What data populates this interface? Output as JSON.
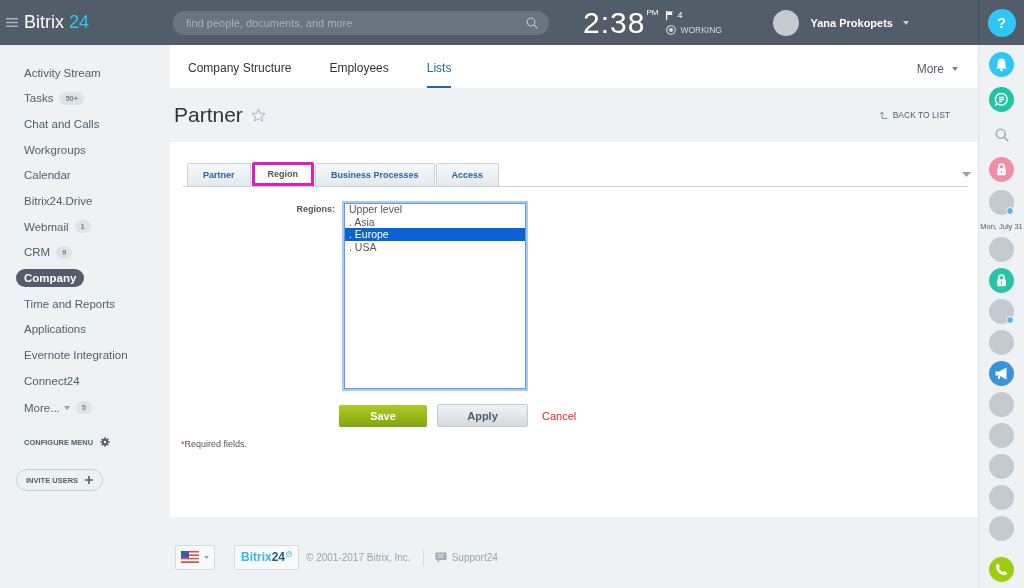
{
  "header": {
    "logo_text": "Bitrix",
    "logo_number": "24",
    "search": {
      "placeholder": "find people, documents, and more"
    },
    "time": "2:38",
    "meridiem": "PM",
    "flag_count": "4",
    "status": "WORKING",
    "user_name": "Yana Prokopets",
    "help_label": "?"
  },
  "sidebar": {
    "items": [
      {
        "label": "Activity Stream",
        "kind": "link",
        "selected": false
      },
      {
        "label": "Tasks",
        "kind": "link",
        "badge": "50+",
        "selected": false
      },
      {
        "label": "Chat and Calls",
        "kind": "link",
        "selected": false
      },
      {
        "label": "Workgroups",
        "kind": "link",
        "selected": false
      },
      {
        "label": "Calendar",
        "kind": "link",
        "selected": false
      },
      {
        "label": "Bitrix24.Drive",
        "kind": "link",
        "selected": false
      },
      {
        "label": "Webmail",
        "kind": "link",
        "badge": "1",
        "selected": false
      },
      {
        "label": "CRM",
        "kind": "link",
        "badge": "9",
        "selected": false
      },
      {
        "label": "Company",
        "kind": "link",
        "selected": true
      },
      {
        "label": "Time and Reports",
        "kind": "link",
        "selected": false
      },
      {
        "label": "Applications",
        "kind": "link",
        "selected": false
      },
      {
        "label": "Evernote Integration",
        "kind": "link",
        "selected": false
      },
      {
        "label": "Connect24",
        "kind": "link",
        "selected": false
      },
      {
        "label": "More...",
        "kind": "menu",
        "badge": "5",
        "selected": false
      }
    ],
    "configure_label": "CONFIGURE MENU",
    "invite_label": "INVITE USERS"
  },
  "nav": {
    "tabs": [
      {
        "label": "Company Structure",
        "selected": false
      },
      {
        "label": "Employees",
        "selected": false
      },
      {
        "label": "Lists",
        "selected": true
      }
    ],
    "more_label": "More"
  },
  "page": {
    "title": "Partner",
    "back_label": "BACK TO LIST"
  },
  "form": {
    "tabs": [
      {
        "label": "Partner",
        "selected": false,
        "highlighted": false
      },
      {
        "label": "Region",
        "selected": true,
        "highlighted": true
      },
      {
        "label": "Business Processes",
        "selected": false,
        "highlighted": false
      },
      {
        "label": "Access",
        "selected": false,
        "highlighted": false
      }
    ],
    "field_label": "Regions:",
    "options": [
      {
        "label": "Upper level",
        "selected": false
      },
      {
        "label": ". Asia",
        "selected": false
      },
      {
        "label": ". Europe",
        "selected": true
      },
      {
        "label": ". USA",
        "selected": false
      }
    ],
    "buttons": {
      "save": "Save",
      "apply": "Apply",
      "cancel": "Cancel"
    },
    "required_mark": "*",
    "required_note": "Required fields."
  },
  "footer": {
    "logo_text": "Bitrix",
    "logo_number": "24",
    "copyright": "© 2001-2017 Bitrix, Inc.",
    "support_label": "Support24"
  },
  "rail": {
    "items": [
      {
        "kind": "bell",
        "color": "#2fc6f6"
      },
      {
        "kind": "chat",
        "color": "#1ec6a6"
      },
      {
        "kind": "search"
      },
      {
        "kind": "lock",
        "color": "#ef8fa5"
      },
      {
        "kind": "avatar",
        "online": true
      },
      {
        "kind": "date",
        "label": "Mon, July 31"
      },
      {
        "kind": "avatar",
        "online": false
      },
      {
        "kind": "lock",
        "color": "#29c3a7"
      },
      {
        "kind": "avatar",
        "online": true
      },
      {
        "kind": "avatar",
        "online": false
      },
      {
        "kind": "megaphone",
        "color": "#3a93d8"
      },
      {
        "kind": "avatar",
        "online": false
      },
      {
        "kind": "avatar",
        "online": false
      },
      {
        "kind": "avatar",
        "online": false
      },
      {
        "kind": "avatar",
        "online": false
      },
      {
        "kind": "avatar",
        "online": false
      },
      {
        "kind": "phone",
        "color": "#9dcd0e"
      }
    ]
  }
}
